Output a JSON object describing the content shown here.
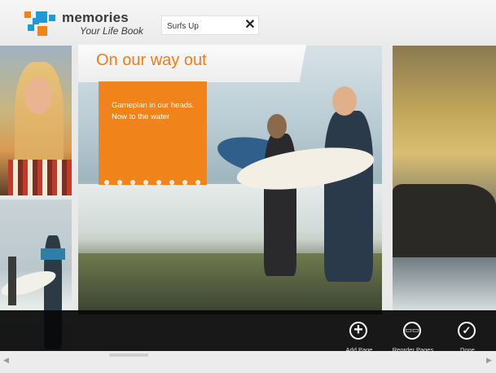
{
  "app": {
    "title": "memories",
    "subtitle": "Your Life Book"
  },
  "page_title_field": {
    "value": "Surfs Up"
  },
  "caption": {
    "title": "On our way out"
  },
  "note": {
    "text": "Gameplan in our heads. Now to the water"
  },
  "app_bar": {
    "buttons": [
      {
        "label": "Add Page",
        "icon": "plus-icon"
      },
      {
        "label": "Reorder Pages",
        "icon": "reorder-pages-icon"
      },
      {
        "label": "Done",
        "icon": "checkmark-icon"
      }
    ]
  },
  "colors": {
    "accent": "#f0831a",
    "logo_blue": "#1e9ad6",
    "logo_orange": "#f0831a"
  }
}
